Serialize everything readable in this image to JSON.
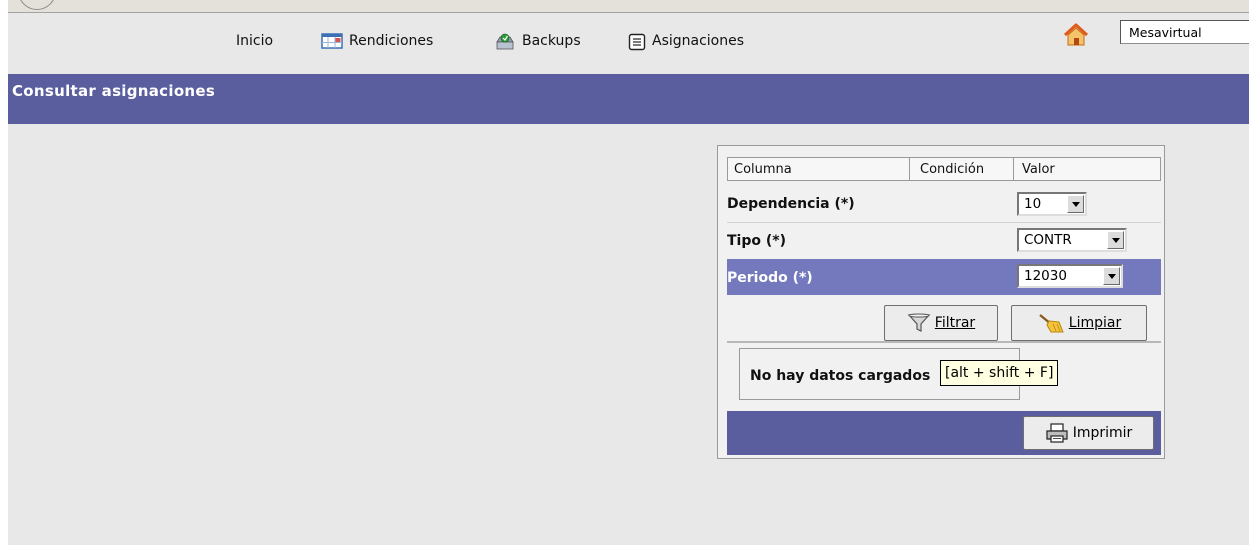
{
  "nav": {
    "items": [
      {
        "label": "Inicio",
        "icon": "none"
      },
      {
        "label": "Rendiciones",
        "icon": "calendar-icon"
      },
      {
        "label": "Backups",
        "icon": "backup-icon"
      },
      {
        "label": "Asignaciones",
        "icon": "document-icon"
      }
    ],
    "site_select_value": "Mesavirtual"
  },
  "page_title": "Consultar asignaciones",
  "filter_table": {
    "headers": [
      "Columna",
      "Condición",
      "Valor"
    ],
    "rows": [
      {
        "label": "Dependencia (*)",
        "value": "10",
        "highlighted": false
      },
      {
        "label": "Tipo (*)",
        "value": "CONTR",
        "highlighted": false
      },
      {
        "label": "Periodo (*)",
        "value": "12030",
        "highlighted": true
      }
    ]
  },
  "buttons": {
    "filter_label": "Filtrar",
    "filter_mnemonic": "F",
    "clear_label": "Limpiar",
    "clear_mnemonic": "L",
    "print_label": "Imprimir"
  },
  "message": "No hay datos cargados",
  "tooltip": "[alt + shift + F]",
  "colors": {
    "header_bar": "#5a5e9e",
    "row_highlight": "#7479bd",
    "page_bg": "#e8e8e8",
    "tooltip_bg": "#ffffe1"
  }
}
